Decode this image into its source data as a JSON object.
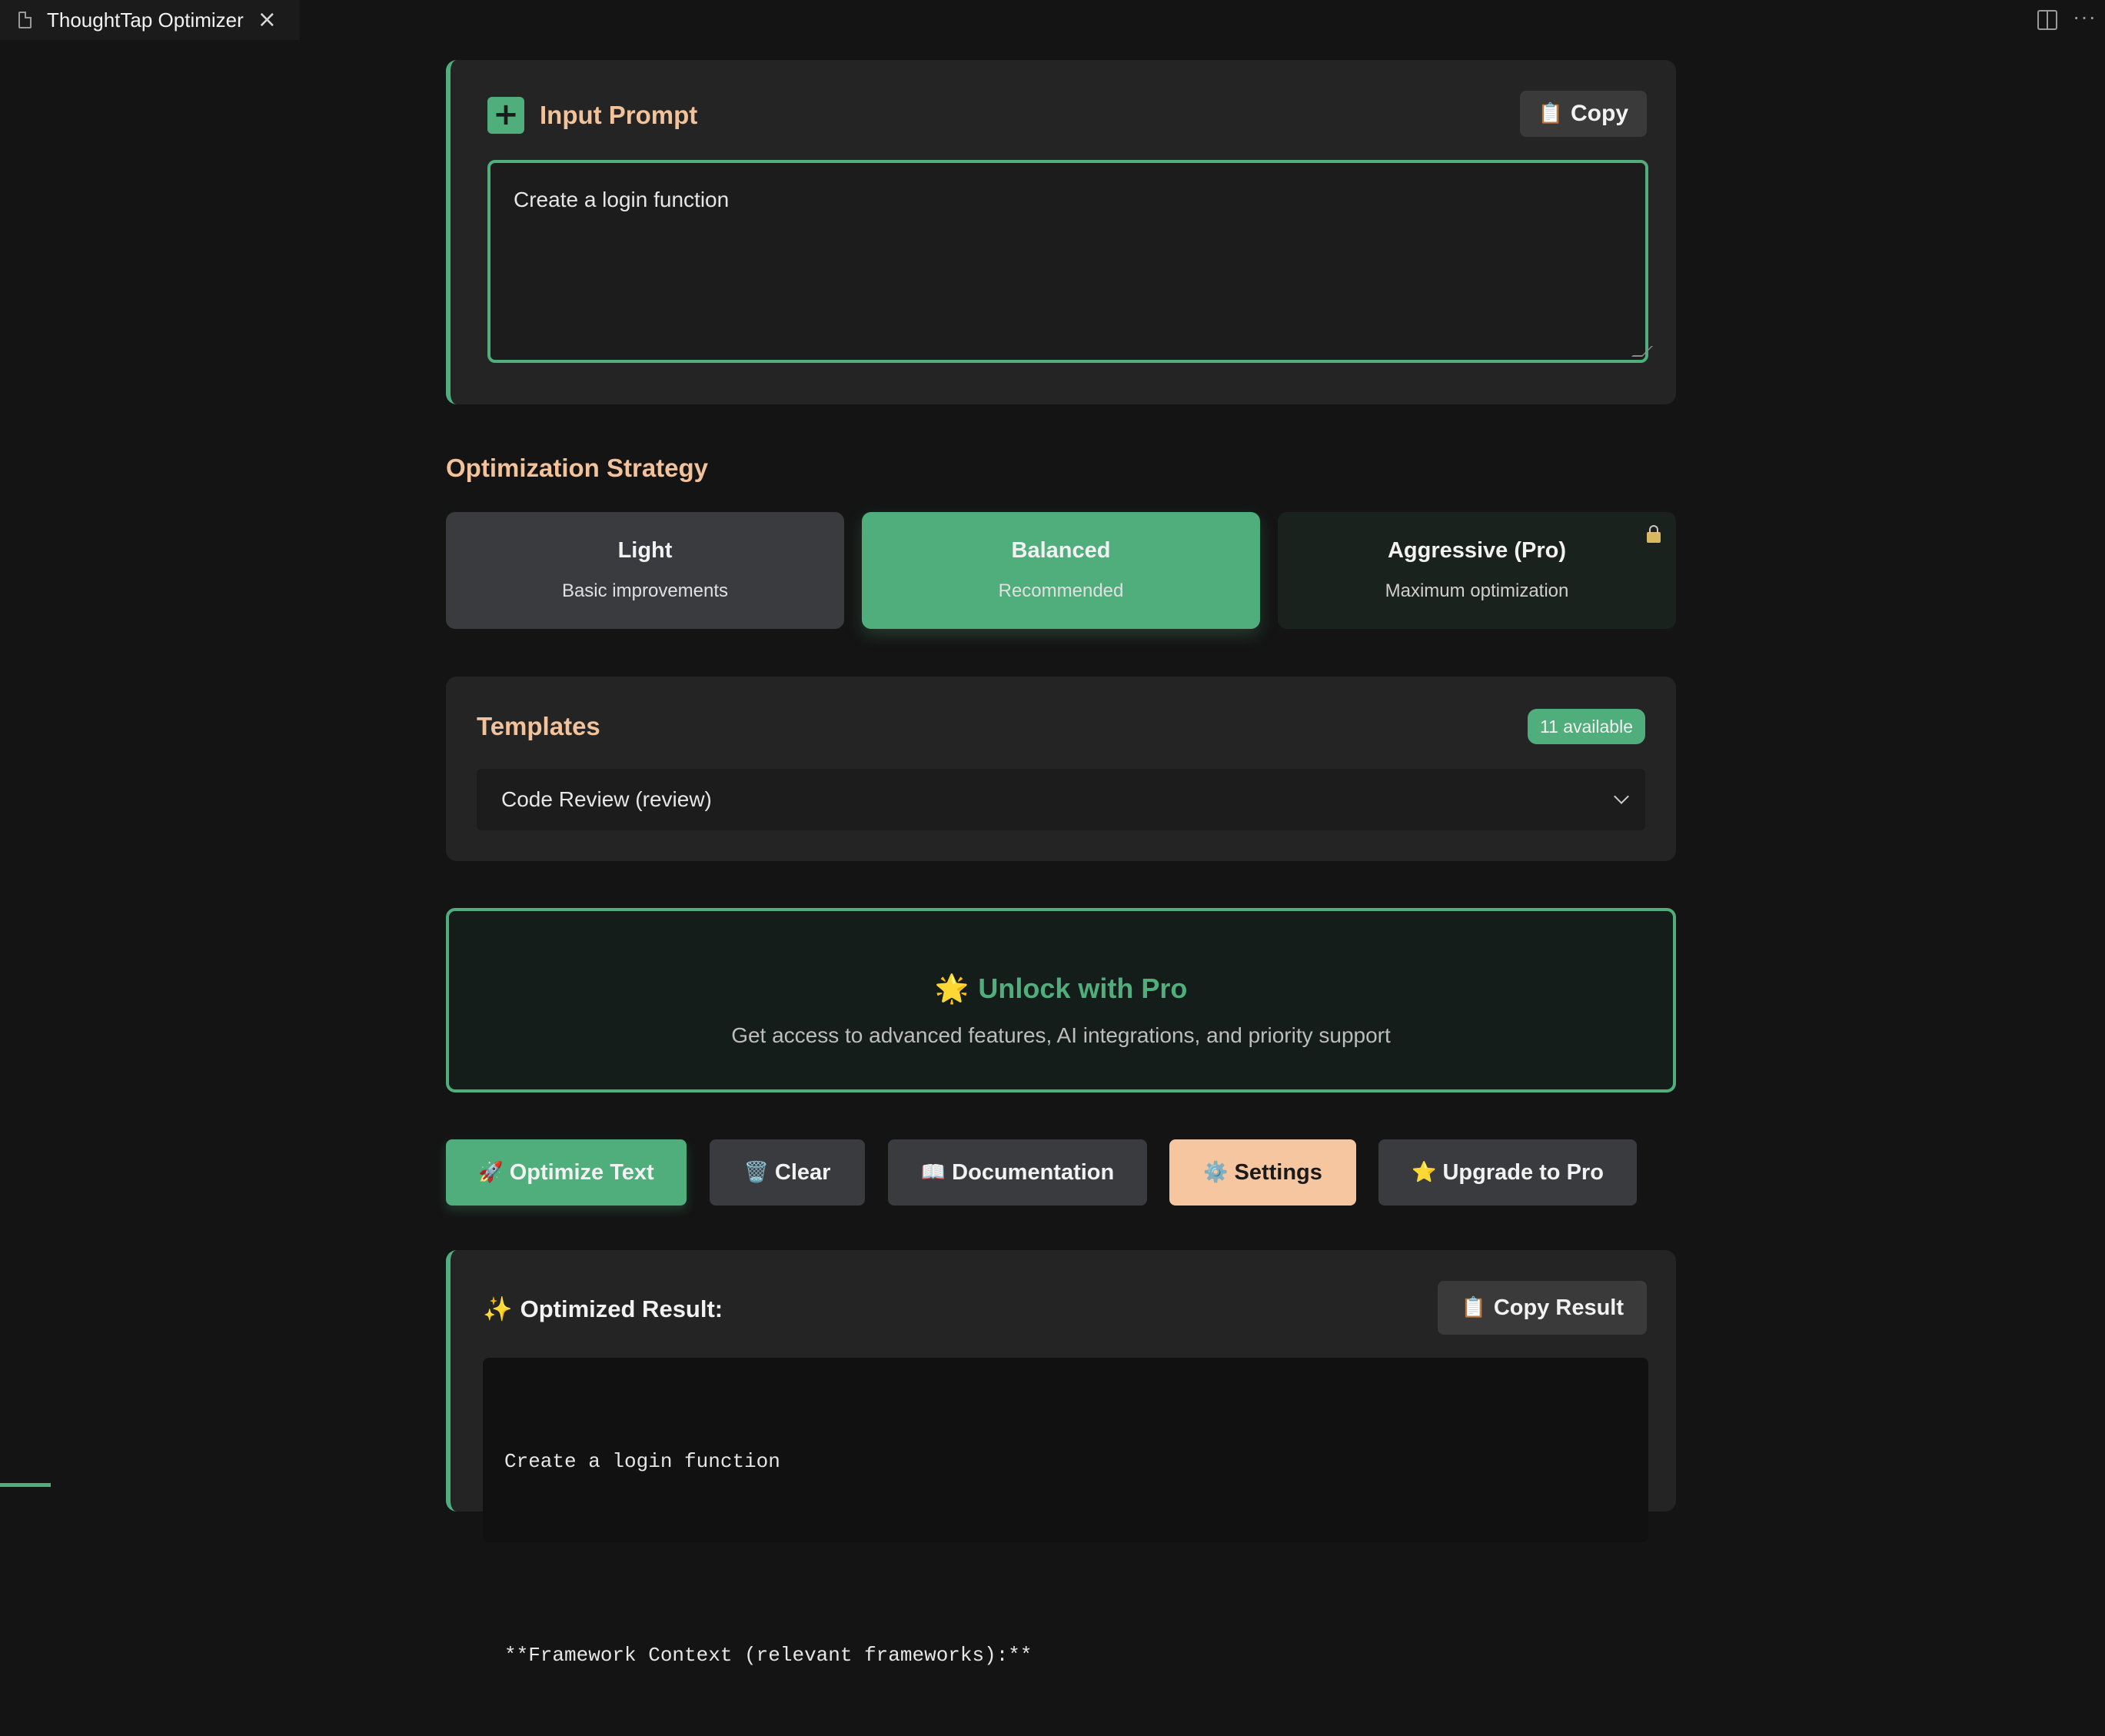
{
  "tab": {
    "title": "ThoughtTap Optimizer",
    "close_glyph": "×"
  },
  "input": {
    "title": "Input Prompt",
    "copy_label": "Copy",
    "copy_icon": "📋",
    "plus_glyph": "+",
    "value": "Create a login function"
  },
  "strategy": {
    "title": "Optimization Strategy",
    "options": [
      {
        "name": "Light",
        "desc": "Basic improvements",
        "selected": false,
        "locked": false
      },
      {
        "name": "Balanced",
        "desc": "Recommended",
        "selected": true,
        "locked": false
      },
      {
        "name": "Aggressive (Pro)",
        "desc": "Maximum optimization",
        "selected": false,
        "locked": true
      }
    ]
  },
  "templates": {
    "title": "Templates",
    "badge": "11 available",
    "selected": "Code Review (review)"
  },
  "pro_banner": {
    "icon": "🌟",
    "title": "Unlock with Pro",
    "desc": "Get access to advanced features, AI integrations, and priority support"
  },
  "actions": {
    "optimize": {
      "icon": "🚀",
      "label": "Optimize Text"
    },
    "clear": {
      "icon": "🗑️",
      "label": "Clear"
    },
    "documentation": {
      "icon": "📖",
      "label": "Documentation"
    },
    "settings": {
      "icon": "⚙️",
      "label": "Settings"
    },
    "upgrade": {
      "icon": "⭐",
      "label": "Upgrade to Pro"
    }
  },
  "result": {
    "icon": "✨",
    "title": "Optimized Result:",
    "copy_icon": "📋",
    "copy_label": "Copy Result",
    "lines": [
      "Create a login function",
      "",
      "**Framework Context (relevant frameworks):**"
    ]
  },
  "colors": {
    "accent": "#4fae7c",
    "heading": "#f2c29b",
    "settings_bg": "#f5c6a0",
    "background": "#141414",
    "card": "#242424"
  }
}
